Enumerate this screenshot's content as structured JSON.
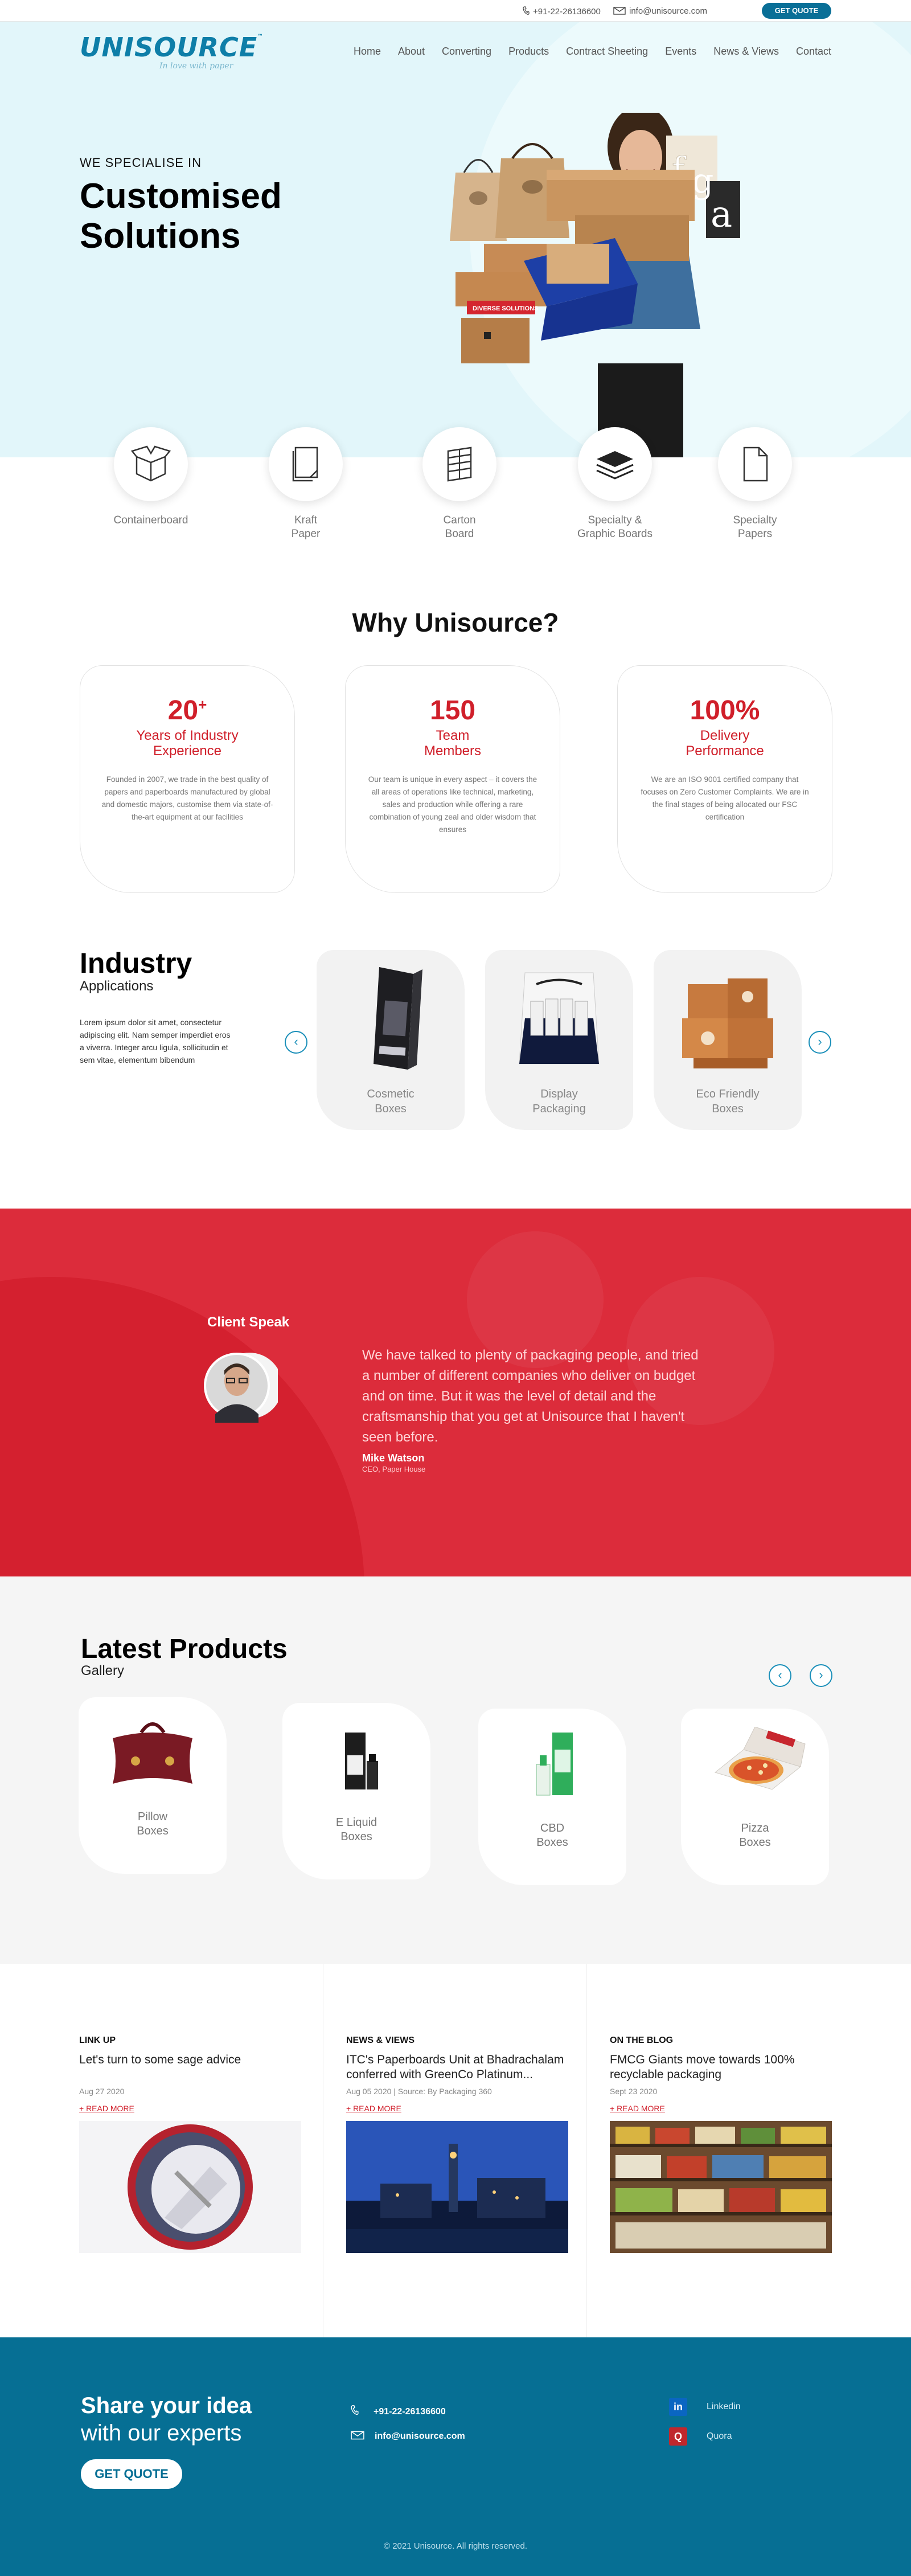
{
  "topbar": {
    "phone": "+91-22-26136600",
    "email": "info@unisource.com",
    "quote_label": "GET QUOTE"
  },
  "logo": {
    "word": "UNISOURCE",
    "tm": "™",
    "tagline": "In love with paper"
  },
  "nav": [
    "Home",
    "About",
    "Converting",
    "Products",
    "Contract Sheeting",
    "Events",
    "News & Views",
    "Contact"
  ],
  "hero": {
    "eyebrow": "WE SPECIALISE IN",
    "title_line1": "Customised",
    "title_line2": "Solutions",
    "box_label": "DIVERSE SOLUTIONS"
  },
  "categories": [
    {
      "label": "Containerboard",
      "icon": "box-icon"
    },
    {
      "label": "Kraft\nPaper",
      "icon": "kraft-paper-icon"
    },
    {
      "label": "Carton\nBoard",
      "icon": "carton-board-icon"
    },
    {
      "label": "Specialty &\nGraphic Boards",
      "icon": "layers-icon"
    },
    {
      "label": "Specialty\nPapers",
      "icon": "document-icon"
    }
  ],
  "why": {
    "title": "Why Unisource?",
    "cards": [
      {
        "num": "20",
        "sup": "+",
        "caption": "Years of Industry\nExperience",
        "desc": "Founded in 2007, we trade in the best quality of papers and paperboards manufactured by global and domestic majors, customise them via state-of-the-art equipment at our facilities"
      },
      {
        "num": "150",
        "sup": "",
        "caption": "Team\nMembers",
        "desc": "Our team is unique in every aspect – it covers the all areas of operations like technical, marketing, sales and production while offering a rare combination of young zeal and older wisdom that ensures"
      },
      {
        "num": "100%",
        "sup": "",
        "caption": "Delivery\nPerformance",
        "desc": "We are an ISO 9001 certified company that focuses on Zero Customer Complaints. We are in the final stages of being allocated our FSC certification"
      }
    ]
  },
  "industry": {
    "title": "Industry",
    "subtitle": "Applications",
    "desc": "Lorem ipsum dolor sit amet, consectetur adipiscing elit. Nam semper imperdiet eros a viverra. Integer arcu ligula, sollicitudin et sem vitae, elementum bibendum",
    "prev": "‹",
    "next": "›",
    "items": [
      {
        "label": "Cosmetic\nBoxes"
      },
      {
        "label": "Display\nPackaging"
      },
      {
        "label": "Eco Friendly\nBoxes"
      }
    ]
  },
  "testimonial": {
    "label": "Client Speak",
    "quote": "We have talked to plenty of packaging people, and tried a number of different companies who deliver on budget and on time. But it was the level of detail and the craftsmanship that you get at Unisource that I haven't seen before.",
    "name": "Mike Watson",
    "role": "CEO, Paper House"
  },
  "latest": {
    "title": "Latest Products",
    "subtitle": "Gallery",
    "prev": "‹",
    "next": "›",
    "items": [
      {
        "label": "Pillow\nBoxes"
      },
      {
        "label": "E Liquid\nBoxes"
      },
      {
        "label": "CBD\nBoxes"
      },
      {
        "label": "Pizza\nBoxes"
      }
    ]
  },
  "news": [
    {
      "category": "LINK UP",
      "title": "Let's turn to some sage advice",
      "date": "Aug 27 2020",
      "more": "+ READ MORE"
    },
    {
      "category": "NEWS & VIEWS",
      "title": "ITC's Paperboards Unit at Bhadrachalam conferred with GreenCo Platinum...",
      "date": "Aug 05 2020 | Source: By Packaging 360",
      "more": "+ READ MORE"
    },
    {
      "category": "ON THE BLOG",
      "title": "FMCG Giants move towards 100% recyclable packaging",
      "date": "Sept 23 2020",
      "more": "+ READ MORE"
    }
  ],
  "footer": {
    "line1": "Share your idea",
    "line2": "with our experts",
    "cta": "GET QUOTE",
    "phone": "+91-22-26136600",
    "email": "info@unisource.com",
    "social": [
      {
        "name": "Linkedin",
        "icon": "linkedin-icon",
        "glyph": "in",
        "color": "#0a66c2"
      },
      {
        "name": "Quora",
        "icon": "quora-icon",
        "glyph": "Q",
        "color": "#c0272d"
      }
    ],
    "copyright": "© 2021 Unisource. All rights reserved."
  }
}
